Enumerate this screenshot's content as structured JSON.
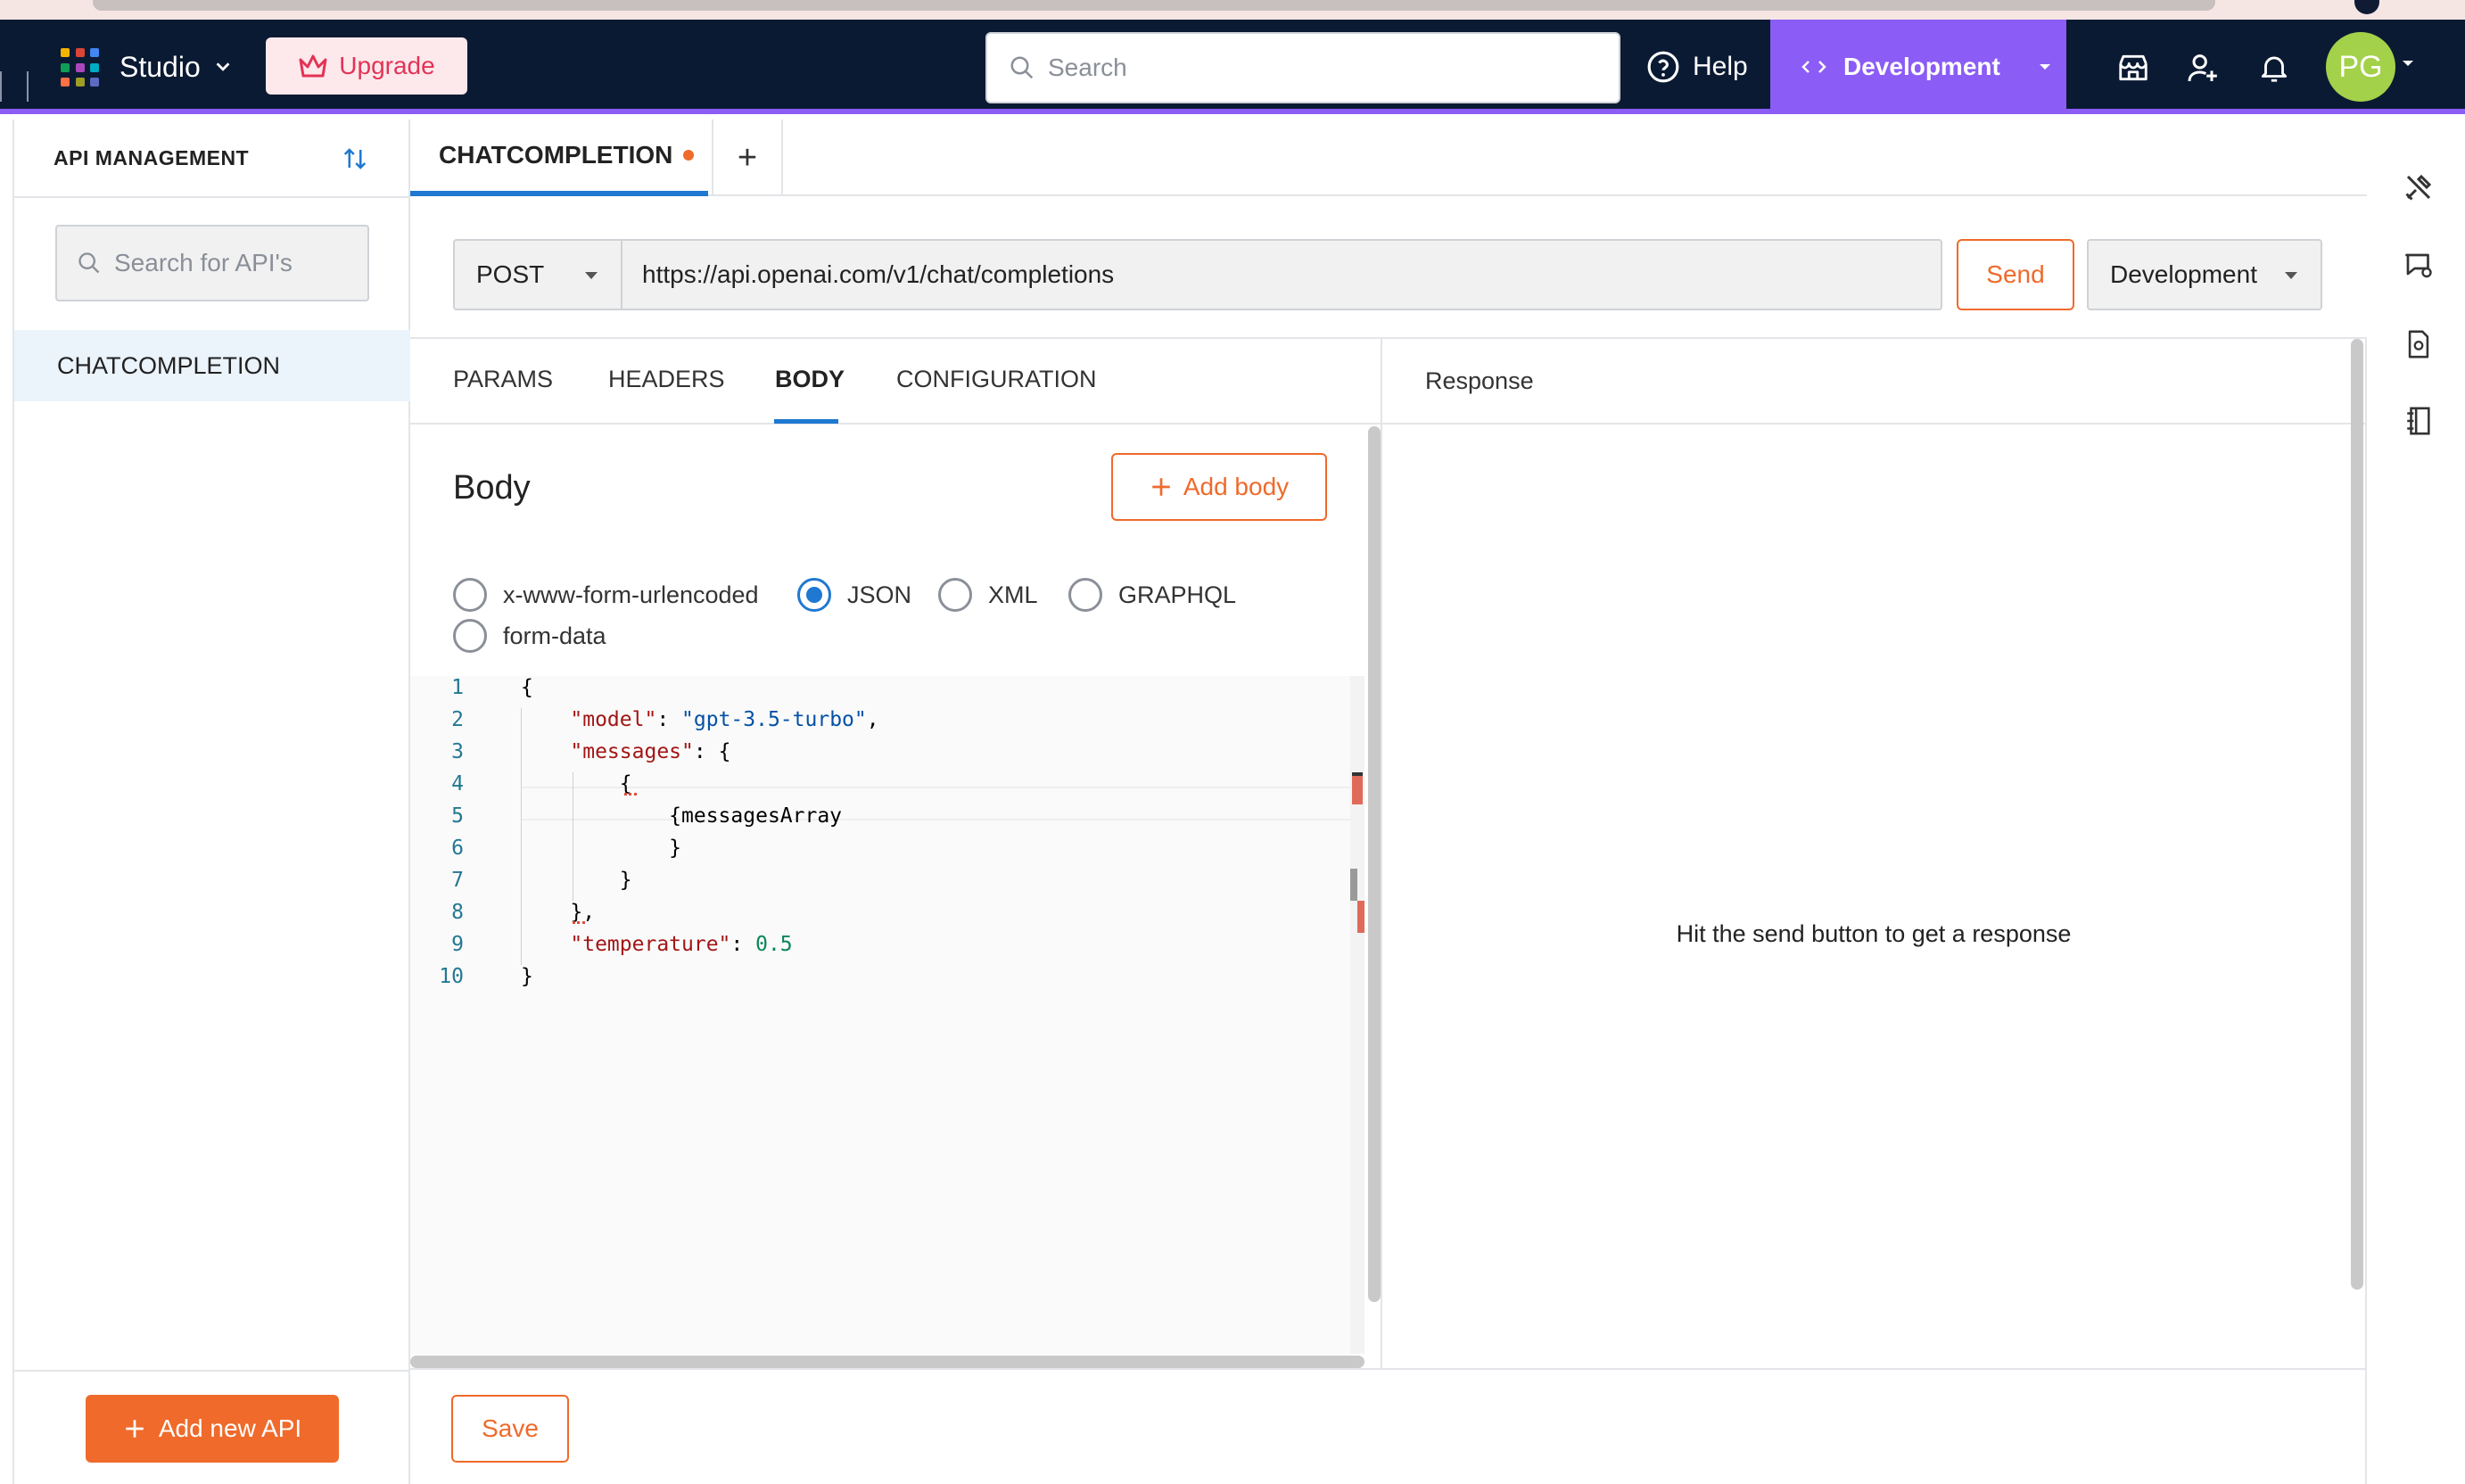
{
  "navbar": {
    "app_label": "Studio",
    "upgrade_label": "Upgrade",
    "search_placeholder": "Search",
    "help_label": "Help",
    "environment_label": "Development",
    "avatar_initials": "PG",
    "colors": {
      "navbar_bg": "#0b1a33",
      "env_bg": "#8b5cf6",
      "upgrade_text": "#e23355",
      "avatar_bg": "#a3d14a"
    }
  },
  "sidebar": {
    "title": "API MANAGEMENT",
    "search_placeholder": "Search for API's",
    "items": [
      {
        "label": "CHATCOMPLETION",
        "selected": true
      }
    ],
    "add_button_label": "Add new API"
  },
  "tabs": {
    "active_tab_label": "CHATCOMPLETION",
    "unsaved": true,
    "add_tab_label": "+"
  },
  "request": {
    "method": "POST",
    "url": "https://api.openai.com/v1/chat/completions",
    "send_label": "Send",
    "environment": "Development"
  },
  "request_tabs": [
    {
      "label": "PARAMS",
      "active": false
    },
    {
      "label": "HEADERS",
      "active": false
    },
    {
      "label": "BODY",
      "active": true
    },
    {
      "label": "CONFIGURATION",
      "active": false
    }
  ],
  "body": {
    "title": "Body",
    "add_body_label": "Add body",
    "content_types": [
      {
        "label": "x-www-form-urlencoded",
        "checked": false
      },
      {
        "label": "JSON",
        "checked": true
      },
      {
        "label": "XML",
        "checked": false
      },
      {
        "label": "GRAPHQL",
        "checked": false
      },
      {
        "label": "form-data",
        "checked": false
      }
    ],
    "editor_lines": [
      {
        "n": "1",
        "text": "{"
      },
      {
        "n": "2",
        "text": "    \"model\": \"gpt-3.5-turbo\","
      },
      {
        "n": "3",
        "text": "    \"messages\": {"
      },
      {
        "n": "4",
        "text": "        {"
      },
      {
        "n": "5",
        "text": "            {messagesArray"
      },
      {
        "n": "6",
        "text": "            }"
      },
      {
        "n": "7",
        "text": "        }"
      },
      {
        "n": "8",
        "text": "    },"
      },
      {
        "n": "9",
        "text": "    \"temperature\": 0.5"
      },
      {
        "n": "10",
        "text": "}"
      }
    ]
  },
  "response": {
    "title": "Response",
    "empty_message": "Hit the send button to get a response"
  },
  "footer": {
    "save_label": "Save"
  },
  "accent_colors": {
    "primary_orange": "#ef6a2b",
    "primary_blue": "#1f78d1"
  }
}
